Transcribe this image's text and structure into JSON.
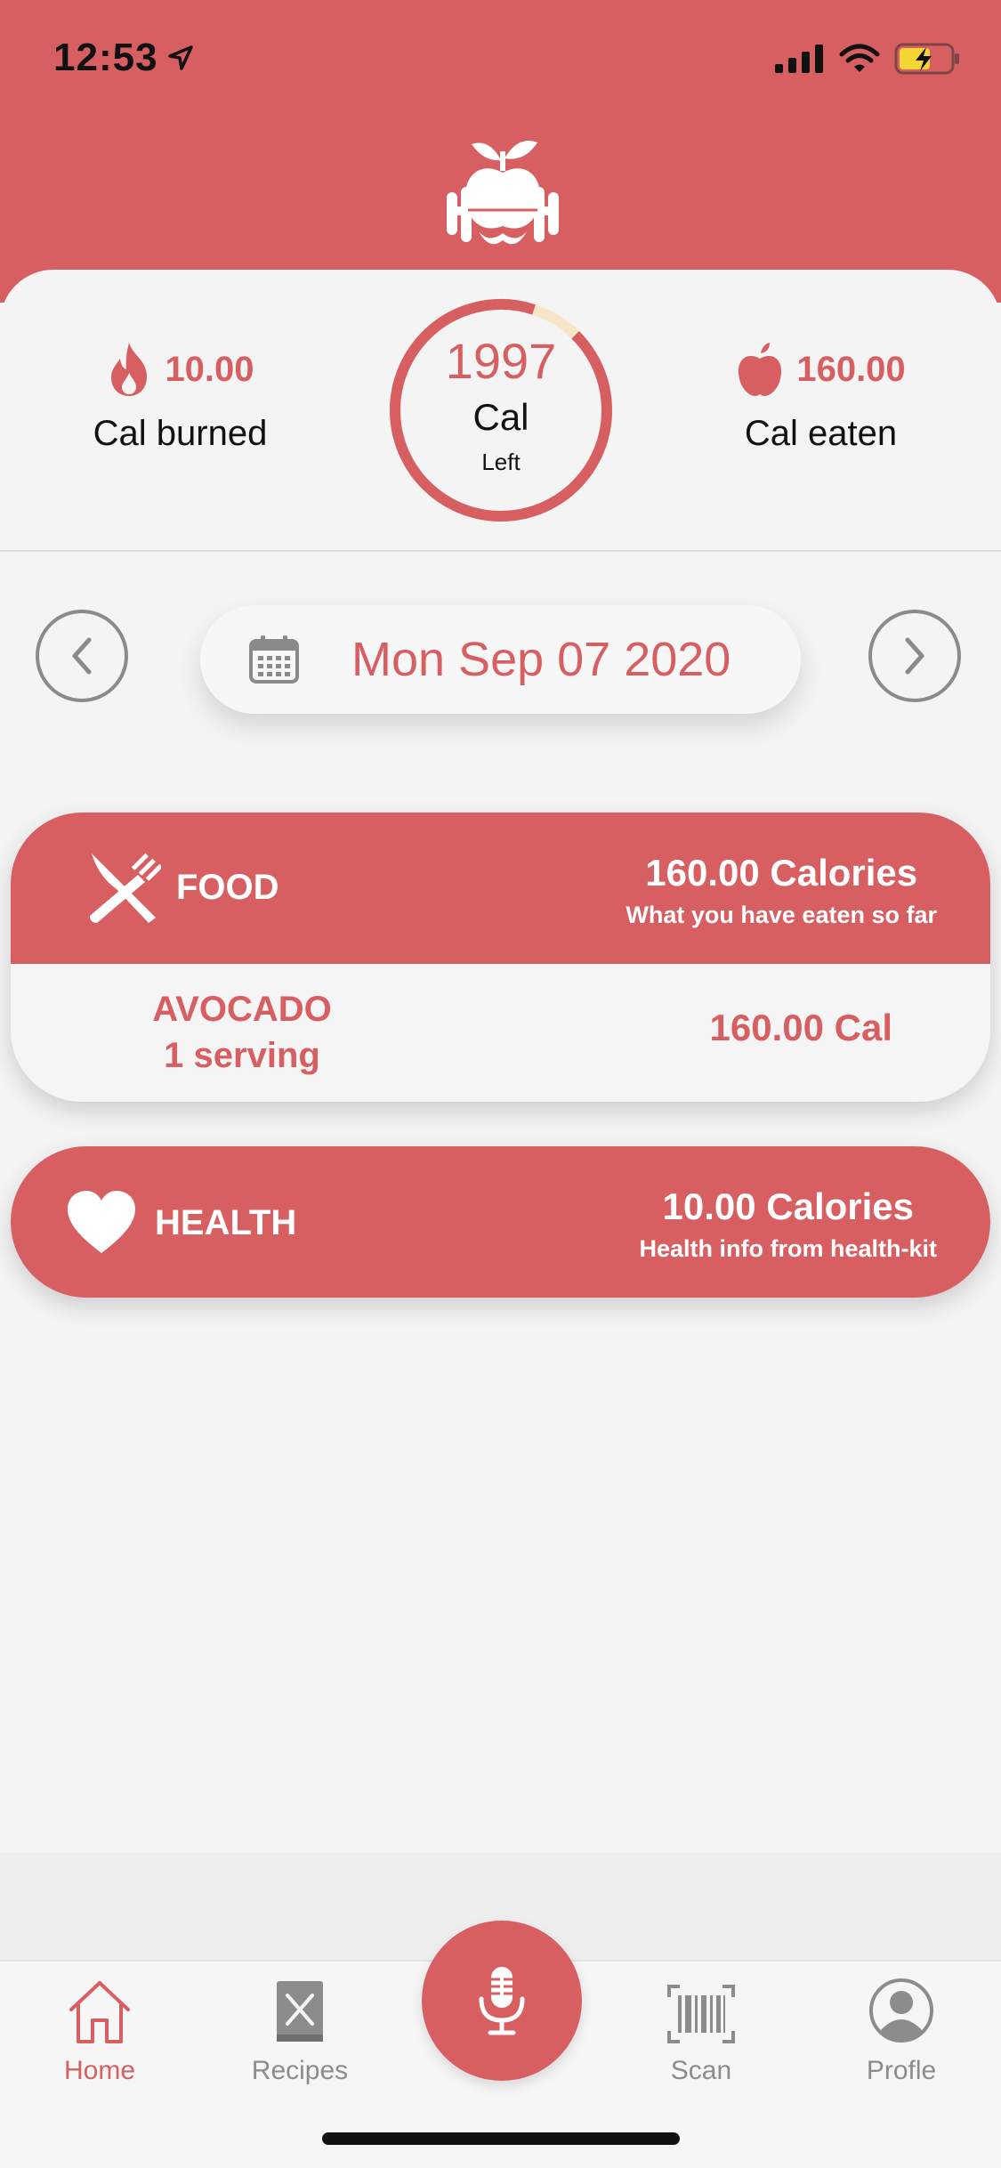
{
  "status_bar": {
    "time": "12:53"
  },
  "summary": {
    "burned_value": "10.00",
    "burned_label": "Cal burned",
    "eaten_value": "160.00",
    "eaten_label": "Cal eaten",
    "ring_number": "1997",
    "ring_unit": "Cal",
    "ring_sub": "Left",
    "ring_consumed_fraction": 0.074
  },
  "date_nav": {
    "date": "Mon Sep 07 2020"
  },
  "food": {
    "title": "FOOD",
    "calories": "160.00 Calories",
    "subtitle": "What you have eaten so far",
    "items": [
      {
        "name": "AVOCADO",
        "serving": "1 serving",
        "calories": "160.00 Cal"
      }
    ]
  },
  "health": {
    "title": "HEALTH",
    "calories": "10.00 Calories",
    "subtitle": "Health info from health-kit"
  },
  "tabs": [
    {
      "label": "Home",
      "icon": "home-icon",
      "active": true
    },
    {
      "label": "Recipes",
      "icon": "recipes-icon",
      "active": false
    },
    {
      "label": "Scan",
      "icon": "barcode-icon",
      "active": false
    },
    {
      "label": "Profle",
      "icon": "profile-icon",
      "active": false
    }
  ],
  "colors": {
    "accent": "#d75f61",
    "ring_remaining": "#f5e6c8",
    "background": "#f4f4f5"
  }
}
